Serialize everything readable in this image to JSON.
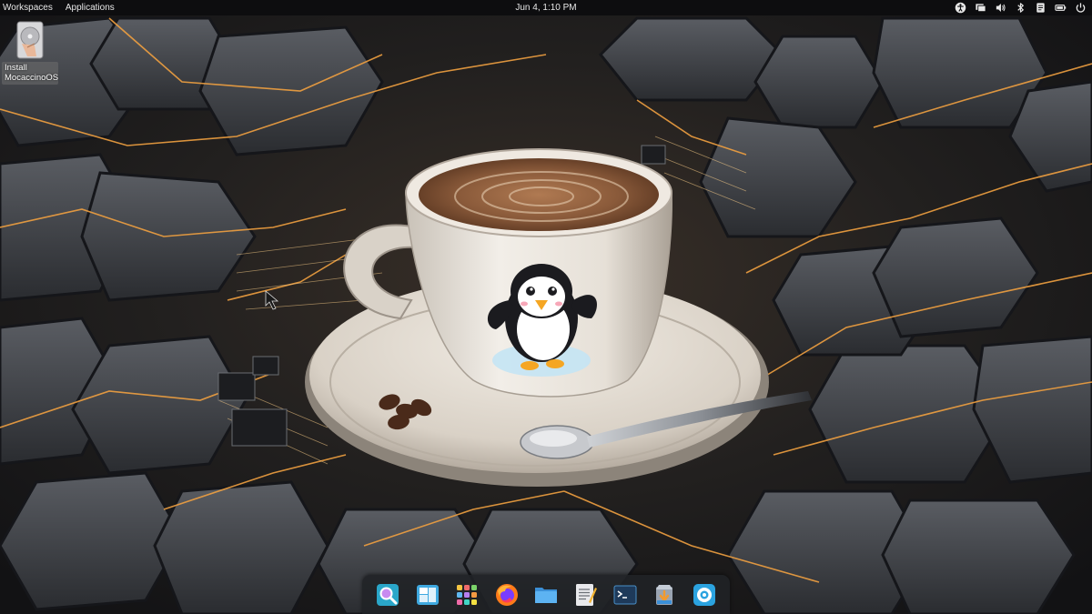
{
  "topbar": {
    "menus": [
      {
        "id": "workspaces",
        "label": "Workspaces"
      },
      {
        "id": "applications",
        "label": "Applications"
      }
    ],
    "clock": "Jun 4, 1:10 PM",
    "tray": [
      {
        "name": "accessibility-icon"
      },
      {
        "name": "display-icon"
      },
      {
        "name": "volume-icon"
      },
      {
        "name": "bluetooth-icon"
      },
      {
        "name": "notes-icon"
      },
      {
        "name": "battery-icon"
      },
      {
        "name": "power-icon"
      }
    ]
  },
  "desktop": {
    "icons": [
      {
        "name": "install-mocaccinoos",
        "label_line1": "Install",
        "label_line2": "MocaccinoOS",
        "icon": "drive-icon"
      }
    ]
  },
  "dock": {
    "items": [
      {
        "name": "search-app-icon"
      },
      {
        "name": "window-manager-icon"
      },
      {
        "name": "app-grid-icon"
      },
      {
        "name": "firefox-icon"
      },
      {
        "name": "files-icon"
      },
      {
        "name": "text-editor-icon"
      },
      {
        "name": "terminal-icon"
      },
      {
        "name": "software-installer-icon"
      },
      {
        "name": "settings-app-icon"
      }
    ]
  },
  "colors": {
    "topbar_bg": "#0d0d0f",
    "dock_bg": "#202226",
    "accent_glow": "#f0a040",
    "cup": "#e9e4dc",
    "coffee": "#8a5a3a"
  }
}
